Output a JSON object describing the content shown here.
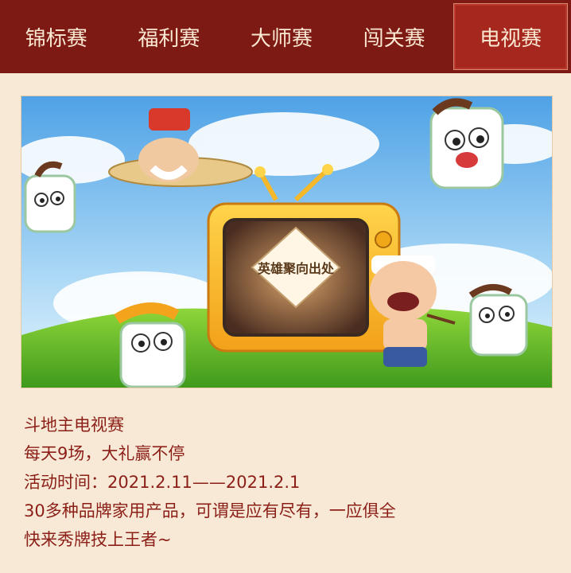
{
  "tabs": [
    {
      "label": "锦标赛",
      "active": false
    },
    {
      "label": "福利赛",
      "active": false
    },
    {
      "label": "大师赛",
      "active": false
    },
    {
      "label": "闯关赛",
      "active": false
    },
    {
      "label": "电视赛",
      "active": true
    }
  ],
  "banner": {
    "tv_logo_text": "英雄聚向出处"
  },
  "description": [
    "斗地主电视赛",
    "每天9场，大礼赢不停",
    "活动时间：2021.2.11——2021.2.1",
    "30多种品牌家用产品，可谓是应有尽有，一应俱全",
    "快来秀牌技上王者~"
  ],
  "colors": {
    "tab_bg": "#7e1a14",
    "tab_active": "#a6271e",
    "text": "#8b1f18",
    "page_bg": "#f8e9d6"
  }
}
